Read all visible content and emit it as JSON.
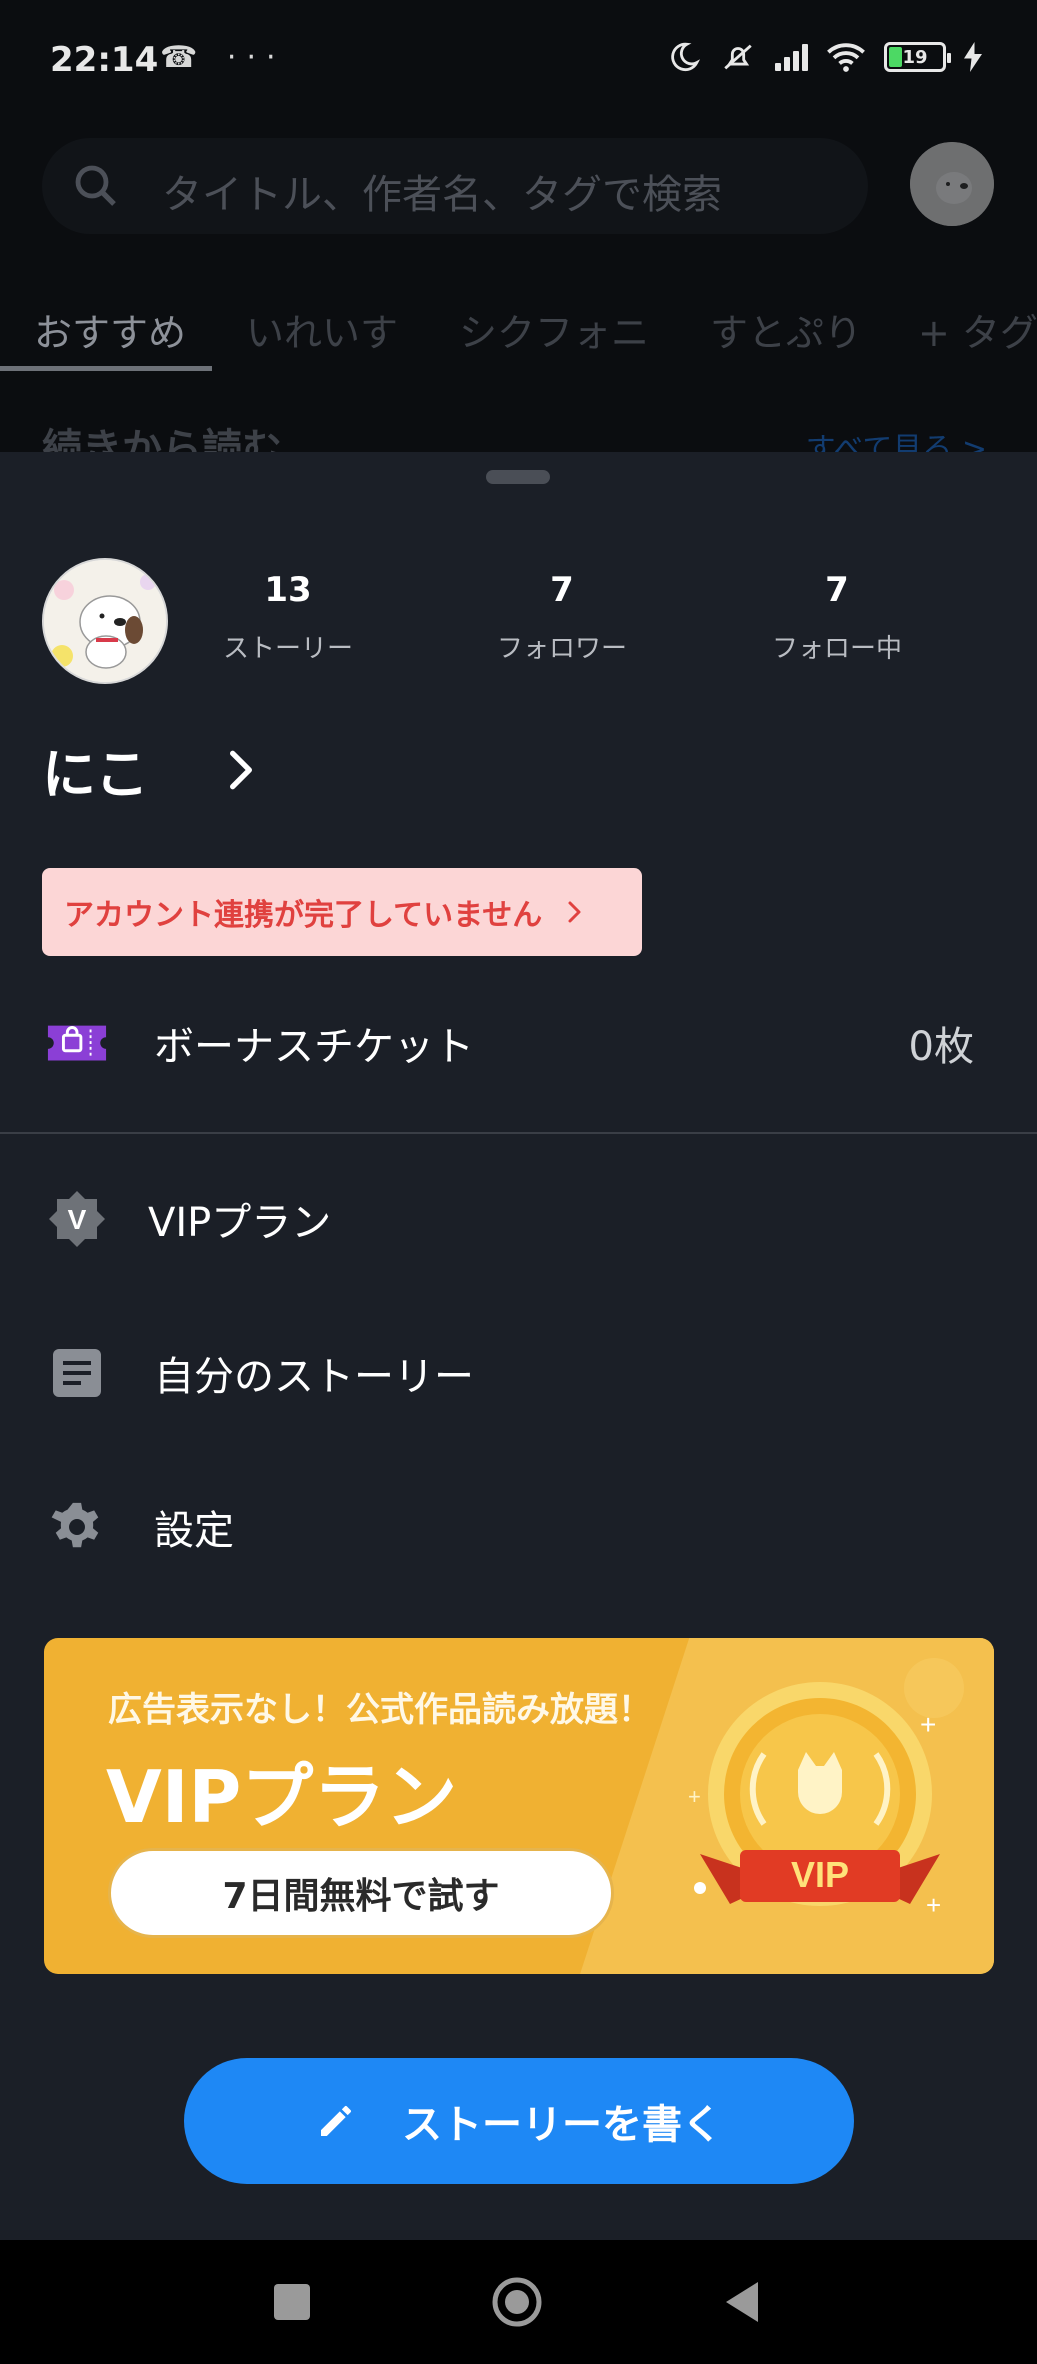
{
  "status_bar": {
    "time": "22:14",
    "left_icons": "☎ ···",
    "battery": "19"
  },
  "search": {
    "placeholder": "タイトル、作者名、タグで検索"
  },
  "tabs": [
    {
      "label": "おすすめ"
    },
    {
      "label": "いれいす"
    },
    {
      "label": "シクフォニ"
    },
    {
      "label": "すとぷり"
    },
    {
      "label": "+ タグ追"
    }
  ],
  "section": {
    "title": "続きから読む",
    "see_all": "すべて見る >"
  },
  "profile": {
    "stats": [
      {
        "value": "13",
        "label": "ストーリー"
      },
      {
        "value": "7",
        "label": "フォロワー"
      },
      {
        "value": "7",
        "label": "フォロー中"
      }
    ],
    "username": "にこ"
  },
  "account_warning": "アカウント連携が完了していません",
  "menu": {
    "bonus_ticket": {
      "label": "ボーナスチケット",
      "value": "0枚"
    },
    "vip_plan": {
      "label": "VIPプラン"
    },
    "my_stories": {
      "label": "自分のストーリー"
    },
    "settings": {
      "label": "設定"
    }
  },
  "vip_banner": {
    "tagline": "広告表示なし！公式作品読み放題！",
    "title": "VIPプラン",
    "cta": "7日間無料で試す",
    "badge": "VIP"
  },
  "write_button": {
    "label": "ストーリーを書く"
  },
  "colors": {
    "sheet_bg": "#1b1f27",
    "accent_blue": "#1e88f5",
    "vip_gold": "#f0b132",
    "warning_bg": "#fcd6d6",
    "warning_text": "#e0413f",
    "ticket_purple": "#8b3fd6"
  },
  "icons": {
    "ticket": "ticket-icon",
    "vip": "vip-badge-icon",
    "stories": "document-icon",
    "settings": "gear-icon",
    "write": "pencil-icon"
  }
}
